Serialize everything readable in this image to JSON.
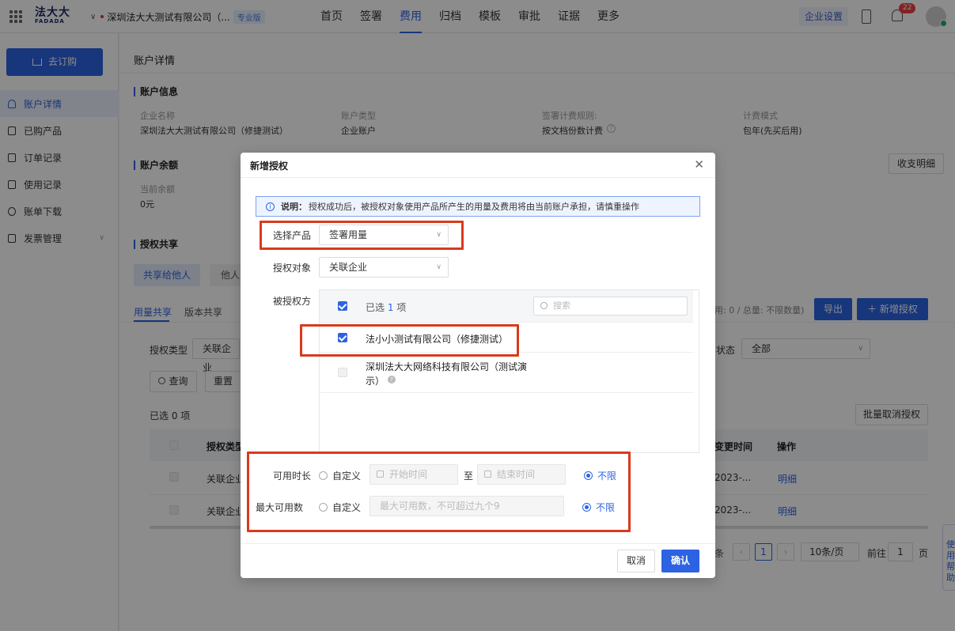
{
  "header": {
    "logo_top": "法大大",
    "logo_bottom": "FADADA",
    "company": "深圳法大大测试有限公司（...",
    "edition": "专业版",
    "nav": [
      "首页",
      "签署",
      "费用",
      "归档",
      "模板",
      "审批",
      "证据",
      "更多"
    ],
    "nav_active": "费用",
    "enterprise_settings": "企业设置",
    "notification_count": "22"
  },
  "sidebar": {
    "order_button": "去订购",
    "items": [
      "账户详情",
      "已购产品",
      "订单记录",
      "使用记录",
      "账单下载",
      "发票管理"
    ],
    "active": "账户详情"
  },
  "main": {
    "page_title": "账户详情",
    "account_info": {
      "title": "账户信息",
      "fields": [
        {
          "label": "企业名称",
          "value": "深圳法大大测试有限公司（修捷测试）"
        },
        {
          "label": "账户类型",
          "value": "企业账户"
        },
        {
          "label": "签署计费规则:",
          "value": "按文档份数计费"
        },
        {
          "label": "计费模式",
          "value": "包年(先买后用)"
        }
      ]
    },
    "balance": {
      "title": "账户余额",
      "label": "当前余额",
      "value": "0元",
      "detail_button": "收支明细"
    },
    "sharing": {
      "title": "授权共享",
      "tabs": [
        "共享给他人",
        "他人"
      ],
      "subtabs": [
        "用量共享",
        "版本共享"
      ],
      "usage_text": "用: 0 / 总量: 不限数量)",
      "export_button": "导出",
      "add_button": "新增授权",
      "filter_type_label": "授权类型",
      "filter_type_value": "关联企业",
      "filter_status_label": "状态",
      "filter_status_value": "全部",
      "query_button": "查询",
      "reset_button": "重置",
      "selected_text": "已选 0 项",
      "batch_cancel_button": "批量取消授权",
      "columns": [
        "授权类型",
        "变更时间",
        "操作"
      ],
      "rows": [
        {
          "type": "关联企业",
          "time": "2023-...",
          "op": "明细"
        },
        {
          "type": "关联企业",
          "time": "2023-...",
          "op": "明细"
        }
      ],
      "pagination": {
        "suffix": "条",
        "current": "1",
        "page_size": "10条/页",
        "goto_label": "前往",
        "goto_value": "1",
        "page_unit": "页"
      }
    },
    "help_side": "使用帮助"
  },
  "dialog": {
    "title": "新增授权",
    "note_label": "说明：",
    "note_text": "授权成功后，被授权对象使用产品所产生的用量及费用将由当前账户承担，请慎重操作",
    "product_label": "选择产品",
    "product_value": "签署用量",
    "target_label": "授权对象",
    "target_value": "关联企业",
    "party_label": "被授权方",
    "selected_prefix": "已选",
    "selected_count": "1",
    "selected_suffix": "项",
    "search_placeholder": "搜索",
    "parties": [
      {
        "name": "法小小测试有限公司（修捷测试）",
        "checked": true
      },
      {
        "name_line1": "深圳法大大网络科技有限公司（测试演",
        "name_line2": "示）",
        "checked": false
      }
    ],
    "duration_label": "可用时长",
    "custom_label": "自定义",
    "start_placeholder": "开始时间",
    "to_text": "至",
    "end_placeholder": "结束时间",
    "unlimited_label": "不限",
    "max_label": "最大可用数",
    "max_placeholder": "最大可用数，不可超过九个9",
    "cancel_button": "取消",
    "confirm_button": "确认"
  }
}
